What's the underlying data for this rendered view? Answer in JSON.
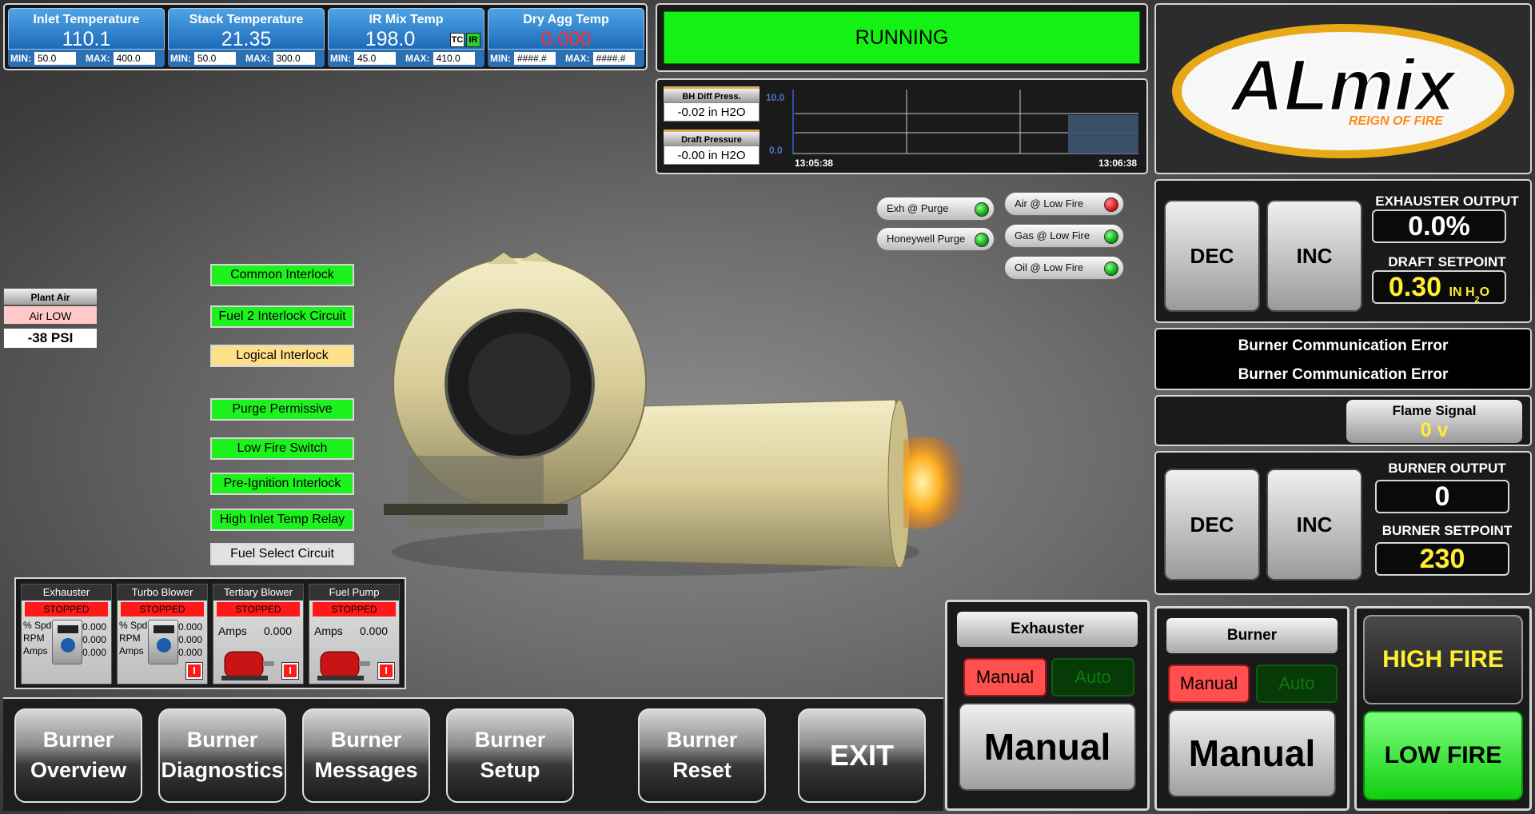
{
  "temps": [
    {
      "title": "Inlet Temperature",
      "value": "110.1",
      "min": "50.0",
      "max": "400.0",
      "value_color": "#ffffff"
    },
    {
      "title": "Stack Temperature",
      "value": "21.35",
      "min": "50.0",
      "max": "300.0",
      "value_color": "#ffffff"
    },
    {
      "title": "IR Mix Temp",
      "value": "198.0",
      "min": "45.0",
      "max": "410.0",
      "value_color": "#ffffff"
    },
    {
      "title": "Dry Agg Temp",
      "value": "0.000",
      "min": "####.#",
      "max": "####.#",
      "value_color": "#ff2e2e"
    }
  ],
  "limits": {
    "min_label": "MIN:",
    "max_label": "MAX:"
  },
  "tc_ir": {
    "tc": "TC",
    "ir": "IR"
  },
  "status": {
    "running": "RUNNING",
    "color": "#14f214"
  },
  "pressure": {
    "bh_title": "BH Diff Press.",
    "bh_value": "-0.02 in H2O",
    "draft_title": "Draft Pressure",
    "draft_value": "-0.00 in H2O"
  },
  "trend": {
    "y_max": "10.0",
    "y_min": "0.0",
    "t_start": "13:05:38",
    "t_end": "13:06:38"
  },
  "logo": {
    "brand": "ALmix",
    "tagline": "REIGN OF FIRE"
  },
  "indicators": {
    "exh_purge": {
      "label": "Exh @ Purge",
      "state": "green"
    },
    "honeywell_purge": {
      "label": "Honeywell Purge",
      "state": "green"
    },
    "air_low_fire": {
      "label": "Air @ Low Fire",
      "state": "red"
    },
    "gas_low_fire": {
      "label": "Gas @ Low Fire",
      "state": "green"
    },
    "oil_low_fire": {
      "label": "Oil @ Low Fire",
      "state": "green"
    }
  },
  "plant_air": {
    "title": "Plant Air",
    "status": "Air LOW",
    "pressure": "-38 PSI"
  },
  "interlocks": [
    {
      "label": "Common Interlock",
      "state": "green"
    },
    {
      "label": "Fuel 2 Interlock Circuit",
      "state": "green"
    },
    {
      "label": "Logical Interlock",
      "state": "yellow"
    },
    {
      "label": "Purge Permissive",
      "state": "green"
    },
    {
      "label": "Low Fire Switch",
      "state": "green"
    },
    {
      "label": "Pre-Ignition Interlock",
      "state": "green"
    },
    {
      "label": "High Inlet Temp Relay",
      "state": "green"
    },
    {
      "label": "Fuel Select Circuit",
      "state": "grey"
    }
  ],
  "motors": [
    {
      "name": "Exhauster",
      "status": "STOPPED",
      "labels": [
        "% Spd",
        "RPM",
        "Amps"
      ],
      "values": [
        "0.000",
        "0.000",
        "0.000"
      ],
      "kind": "vfd"
    },
    {
      "name": "Turbo Blower",
      "status": "STOPPED",
      "labels": [
        "% Spd",
        "RPM",
        "Amps"
      ],
      "values": [
        "0.000",
        "0.000",
        "0.000"
      ],
      "kind": "vfd"
    },
    {
      "name": "Tertiary Blower",
      "status": "STOPPED",
      "labels": [
        "Amps"
      ],
      "values": [
        "0.000"
      ],
      "kind": "motor"
    },
    {
      "name": "Fuel Pump",
      "status": "STOPPED",
      "labels": [
        "Amps"
      ],
      "values": [
        "0.000"
      ],
      "kind": "motor"
    }
  ],
  "motor_stop_label": "I",
  "nav": [
    {
      "line1": "Burner",
      "line2": "Overview"
    },
    {
      "line1": "Burner",
      "line2": "Diagnostics"
    },
    {
      "line1": "Burner",
      "line2": "Messages"
    },
    {
      "line1": "Burner",
      "line2": "Setup"
    },
    {
      "line1": "Burner",
      "line2": "Reset"
    }
  ],
  "exit_label": "EXIT",
  "exhauster_ctrl": {
    "dec": "DEC",
    "inc": "INC",
    "output_label": "EXHAUSTER OUTPUT",
    "output_value": "0.0%",
    "setpoint_label": "DRAFT SETPOINT",
    "setpoint_value": "0.30",
    "setpoint_unit": "IN H",
    "unit_sub": "2",
    "unit_tail": "O"
  },
  "comm": {
    "line1": "Burner Communication Error",
    "line2": "Burner Communication Error"
  },
  "flame": {
    "label": "Flame Signal",
    "value": "0 v"
  },
  "burner_ctrl": {
    "dec": "DEC",
    "inc": "INC",
    "output_label": "BURNER OUTPUT",
    "output_value": "0",
    "setpoint_label": "BURNER SETPOINT",
    "setpoint_value": "230"
  },
  "exhauster_mode": {
    "title": "Exhauster",
    "manual": "Manual",
    "auto": "Auto",
    "mode": "Manual"
  },
  "burner_mode": {
    "title": "Burner",
    "manual": "Manual",
    "auto": "Auto",
    "mode": "Manual"
  },
  "fire": {
    "high": "HIGH FIRE",
    "low": "LOW FIRE"
  }
}
